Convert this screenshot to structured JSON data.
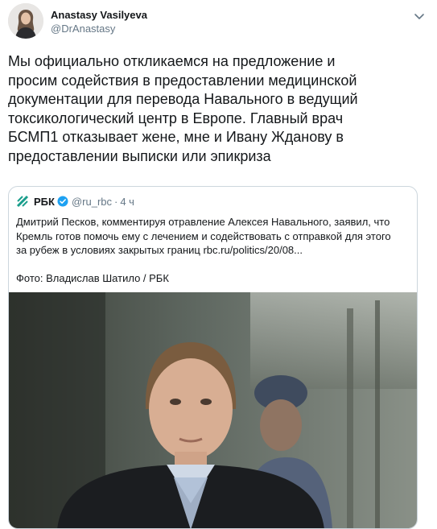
{
  "author": {
    "name": "Anastasy Vasilyeva",
    "handle": "@DrAnastasy"
  },
  "tweet": {
    "text": "Мы официально откликаемся на предложение и\nпросим содействия в предоставлении медицинской\nдокументации для перевода Навального в ведущий\nтоксикологический центр в Европе. Главный врач\nБСМП1 отказывает жене, мне и Ивану Жданову в\nпредоставлении выписки или эпикриза"
  },
  "quote": {
    "name": "РБК",
    "handle": "@ru_rbc",
    "separator": "·",
    "time": "4 ч",
    "text": "Дмитрий Песков, комментируя отравление Алексея Навального, заявил, что\nКремль готов помочь ему с лечением и содействовать с отправкой для этого\nза рубеж в условиях закрытых границ rbc.ru/politics/20/08...",
    "photo_credit": "Фото: Владислав Шатило / РБК",
    "verified_color": "#1da1f2",
    "logo_color": "#1a9e8c"
  },
  "icons": {
    "more": "chevron-down-icon",
    "verified": "verified-badge-icon",
    "logo": "rbc-logo-icon"
  }
}
